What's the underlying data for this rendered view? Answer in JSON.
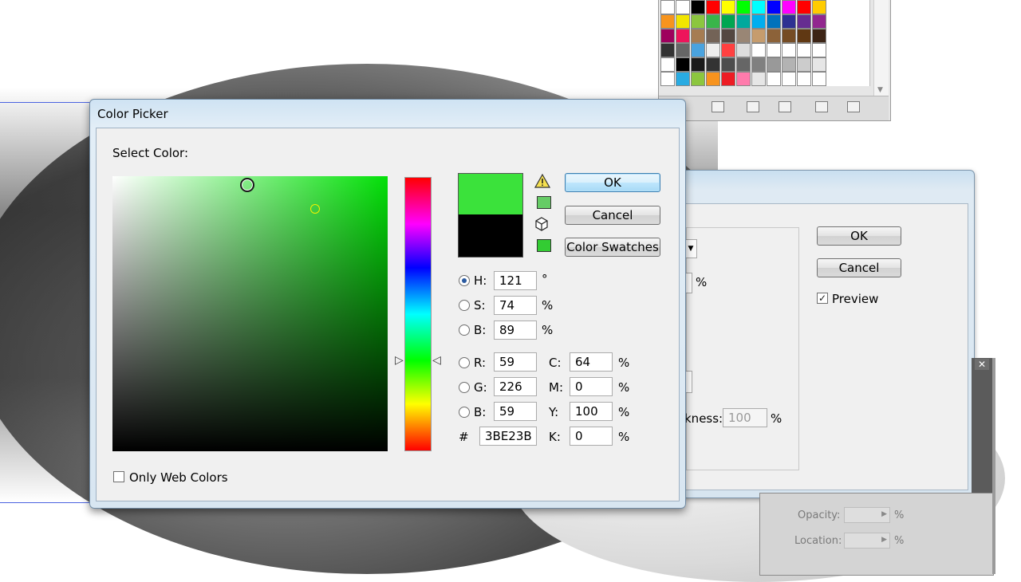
{
  "colors": {
    "selected": "#3BE23B",
    "previous": "#000000",
    "web_safe": "#66CC66",
    "swatch_chip": "#33CC33"
  },
  "color_picker": {
    "title": "Color Picker",
    "select_label": "Select Color:",
    "ok": "OK",
    "cancel": "Cancel",
    "swatches": "Color Swatches",
    "only_web": "Only Web Colors",
    "hsb": [
      {
        "label": "H:",
        "value": "121",
        "unit": "°",
        "selected": true
      },
      {
        "label": "S:",
        "value": "74",
        "unit": "%",
        "selected": false
      },
      {
        "label": "B:",
        "value": "89",
        "unit": "%",
        "selected": false
      }
    ],
    "rgb": [
      {
        "label": "R:",
        "value": "59"
      },
      {
        "label": "G:",
        "value": "226"
      },
      {
        "label": "B:",
        "value": "59"
      }
    ],
    "cmyk": [
      {
        "label": "C:",
        "value": "64",
        "unit": "%"
      },
      {
        "label": "M:",
        "value": "0",
        "unit": "%"
      },
      {
        "label": "Y:",
        "value": "100",
        "unit": "%"
      },
      {
        "label": "K:",
        "value": "0",
        "unit": "%"
      }
    ],
    "hex_label": "#",
    "hex_value": "3BE23B",
    "icons": [
      "warning-icon",
      "web-safe-cube-icon"
    ]
  },
  "right_dialog": {
    "ok": "OK",
    "cancel": "Cancel",
    "preview": "Preview",
    "preview_checked": true,
    "percent": "%",
    "thickness_label": "kness:",
    "thickness_value": "100",
    "thickness_unit": "%"
  },
  "gradient_panel": {
    "opacity_label": "Opacity:",
    "location_label": "Location:",
    "unit": "%"
  },
  "swatch_rows": [
    [
      "#ffffff",
      "#ffffff",
      "#000000",
      "#ff0000",
      "#ffff00",
      "#00ff00",
      "#00ffff",
      "#0000ff",
      "#ff00ff",
      "#ff0000",
      "#ffcc00"
    ],
    [
      "#f7941d",
      "#f2e500",
      "#8cc63f",
      "#39b54a",
      "#00a651",
      "#00a99d",
      "#00aeef",
      "#0072bc",
      "#2e3192",
      "#662d91",
      "#92278f"
    ],
    [
      "#9e005d",
      "#ed145b",
      "#a67c52",
      "#736357",
      "#534741",
      "#998675",
      "#c69c6d",
      "#8c6239",
      "#754c24",
      "#603813",
      "#3c2415"
    ],
    [
      "#333333",
      "#666666",
      "#4aa3df",
      "#eeeeee",
      "#ff4040",
      "#dddddd",
      "#ffffff",
      "#ffffff",
      "#ffffff",
      "#ffffff",
      "#ffffff"
    ],
    [
      "#ffffff",
      "#000000",
      "#1a1a1a",
      "#333333",
      "#4d4d4d",
      "#666666",
      "#808080",
      "#999999",
      "#b3b3b3",
      "#cccccc",
      "#e6e6e6"
    ],
    [
      "#ffffff",
      "#29abe2",
      "#8cc63f",
      "#f7931e",
      "#ed1c24",
      "#ff7bac",
      "#e6e6e6",
      "#ffffff",
      "#ffffff",
      "#ffffff",
      "#ffffff"
    ]
  ]
}
